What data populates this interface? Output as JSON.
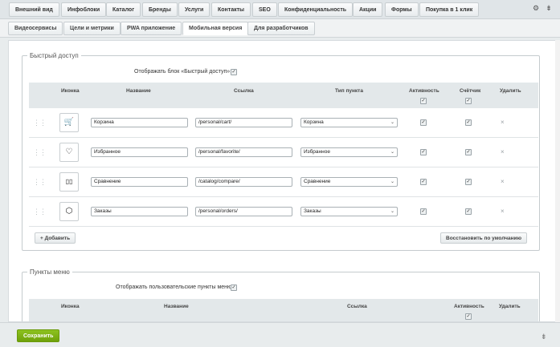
{
  "top_tabs": [
    {
      "label": "Внешний вид"
    },
    {
      "label": "Инфоблоки"
    },
    {
      "label": "Каталог"
    },
    {
      "label": "Бренды"
    },
    {
      "label": "Услуги"
    },
    {
      "label": "Контакты"
    },
    {
      "label": "SEO"
    },
    {
      "label": "Конфиденциальность"
    },
    {
      "label": "Акции"
    },
    {
      "label": "Формы"
    },
    {
      "label": "Покупка в 1 клик"
    }
  ],
  "top_icons": {
    "settings": "gear-icon",
    "pin": "pin-icon"
  },
  "sub_tabs": [
    {
      "label": "Видеосервисы"
    },
    {
      "label": "Цели и метрики"
    },
    {
      "label": "PWA приложение"
    },
    {
      "label": "Мобильная версия"
    },
    {
      "label": "Для разработчиков"
    }
  ],
  "quick_access": {
    "legend": "Быстрый доступ",
    "show_label": "Отображать блок «Быстрый доступ»:",
    "show_checked": "✓",
    "headers": {
      "icon": "Иконка",
      "name": "Название",
      "link": "Ссылка",
      "type": "Тип пункта",
      "active": "Активность",
      "counter": "Счётчик",
      "delete": "Удалить"
    },
    "check": "✓",
    "rows": [
      {
        "icon": "cart-icon",
        "glyph": "🛒",
        "name": "Корзина",
        "link": "/personal/cart/",
        "type": "Корзина",
        "delete": "×"
      },
      {
        "icon": "heart-icon",
        "glyph": "♡",
        "name": "Избранное",
        "link": "/personal/favorite/",
        "type": "Избранное",
        "delete": "×"
      },
      {
        "icon": "compare-icon",
        "glyph": "▯▯",
        "name": "Сравнение",
        "link": "/catalog/compare/",
        "type": "Сравнение",
        "delete": "×"
      },
      {
        "icon": "box-icon",
        "glyph": "⬡",
        "name": "Заказы",
        "link": "/personal/orders/",
        "type": "Заказы",
        "delete": "×"
      }
    ],
    "add_label": "Добавить",
    "add_icon": "+",
    "restore_label": "Восстановить по умолчанию"
  },
  "menu_items": {
    "legend": "Пункты меню",
    "show_label": "Отображать пользовательские пункты меню:",
    "show_checked": "✓",
    "headers": {
      "icon": "Иконка",
      "name": "Название",
      "link": "Ссылка",
      "active": "Активность",
      "delete": "Удалить"
    },
    "check": "✓"
  },
  "footer": {
    "save_label": "Сохранить",
    "pin": "⇟"
  },
  "colors": {
    "save_bg": "#7cb315",
    "table_header": "#e3e8ea"
  }
}
